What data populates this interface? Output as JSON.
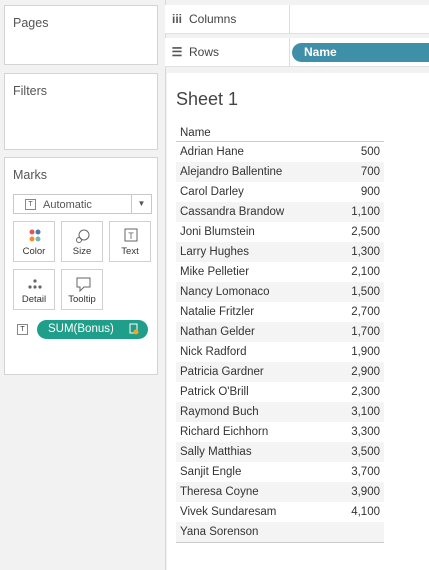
{
  "left": {
    "pages_title": "Pages",
    "filters_title": "Filters",
    "marks_title": "Marks",
    "mark_type": "Automatic",
    "mark_buttons": [
      "Color",
      "Size",
      "Text",
      "Detail",
      "Tooltip"
    ],
    "pill": "SUM(Bonus)"
  },
  "shelves": {
    "columns_label": "Columns",
    "rows_label": "Rows",
    "rows_pill": "Name"
  },
  "sheet": {
    "title": "Sheet 1",
    "header": "Name",
    "rows": [
      {
        "name": "Adrian Hane",
        "value": "500"
      },
      {
        "name": "Alejandro Ballentine",
        "value": "700"
      },
      {
        "name": "Carol Darley",
        "value": "900"
      },
      {
        "name": "Cassandra Brandow",
        "value": "1,100"
      },
      {
        "name": "Joni Blumstein",
        "value": "2,500"
      },
      {
        "name": "Larry Hughes",
        "value": "1,300"
      },
      {
        "name": "Mike Pelletier",
        "value": "2,100"
      },
      {
        "name": "Nancy Lomonaco",
        "value": "1,500"
      },
      {
        "name": "Natalie Fritzler",
        "value": "2,700"
      },
      {
        "name": "Nathan Gelder",
        "value": "1,700"
      },
      {
        "name": "Nick Radford",
        "value": "1,900"
      },
      {
        "name": "Patricia Gardner",
        "value": "2,900"
      },
      {
        "name": "Patrick O'Brill",
        "value": "2,300"
      },
      {
        "name": "Raymond Buch",
        "value": "3,100"
      },
      {
        "name": "Richard Eichhorn",
        "value": "3,300"
      },
      {
        "name": "Sally Matthias",
        "value": "3,500"
      },
      {
        "name": "Sanjit Engle",
        "value": "3,700"
      },
      {
        "name": "Theresa Coyne",
        "value": "3,900"
      },
      {
        "name": "Vivek Sundaresam",
        "value": "4,100"
      },
      {
        "name": "Yana Sorenson",
        "value": ""
      }
    ]
  },
  "colors": {
    "pill": "#1f9e89",
    "rows_pill": "#3f8fa8"
  }
}
